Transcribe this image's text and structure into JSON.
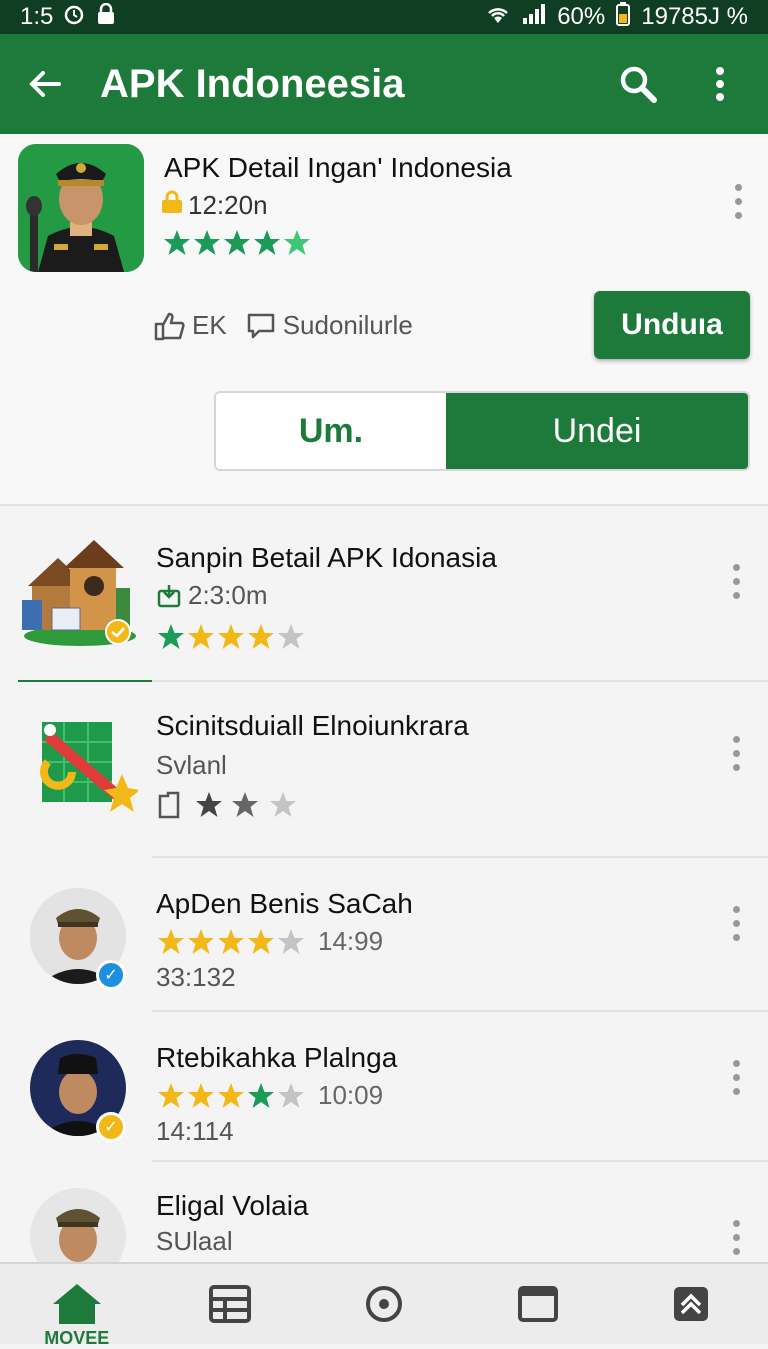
{
  "status_bar": {
    "time": "1:5",
    "battery": "60%",
    "extra": "19785J %"
  },
  "app_bar": {
    "title": "APK Indoneesia"
  },
  "hero": {
    "name": "APK Detail Ingan' Indonesia",
    "meta": "12:20n",
    "chip_like": "EK",
    "chip_comment": "Sudonilurle",
    "primary_button": "Unduıa",
    "seg_left": "Um.",
    "seg_right": "Undei"
  },
  "list": [
    {
      "title": "Sanpin Betail APK Idonasia",
      "meta": "2:3:0m",
      "rating": 4
    },
    {
      "title": "Scinitsduiall Elnoiunkrara",
      "subtitle": "Svlanl",
      "rating": 2
    },
    {
      "title": "ApDen Benis SaCah",
      "rating": 4,
      "time": "14:99",
      "sub": "33:132"
    },
    {
      "title": "Rtebikahka Plalnga",
      "rating": 4,
      "time": "10:09",
      "sub": "14:114"
    },
    {
      "title": "Eligal Volaia",
      "subtitle": "SUlaal"
    }
  ],
  "nav": {
    "home_label": "MOVEE"
  },
  "colors": {
    "primary": "#1d7a3a",
    "dark": "#103e22",
    "star": "#f2b818"
  }
}
